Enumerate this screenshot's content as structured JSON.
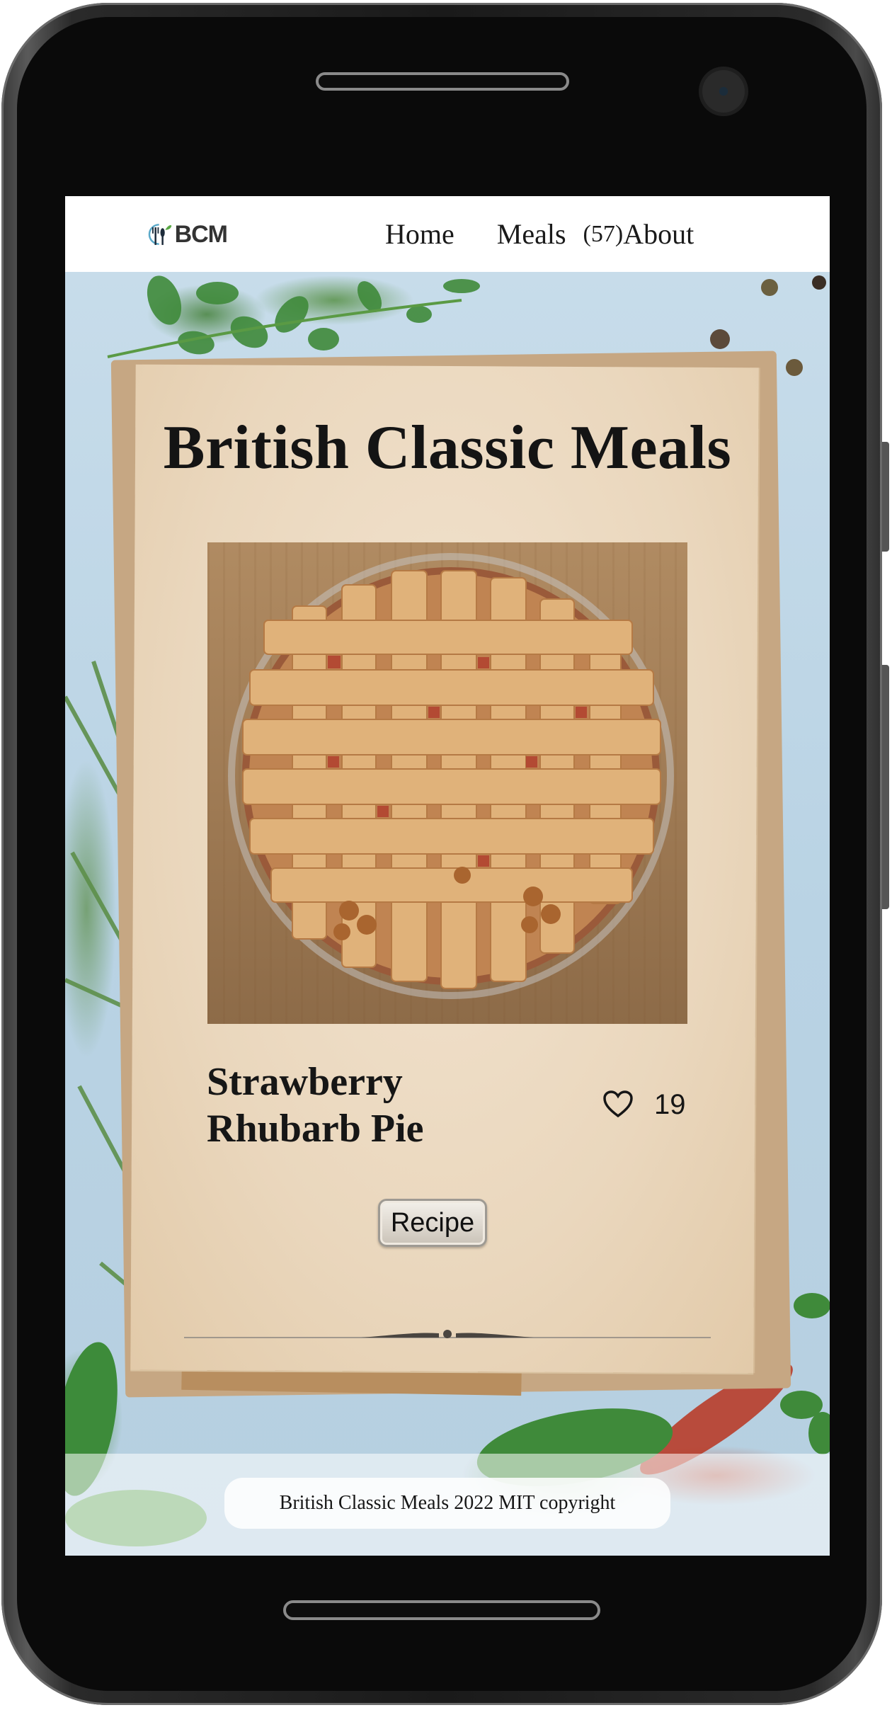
{
  "nav": {
    "logo_text": "BCM",
    "home_label": "Home",
    "meals_label": "Meals",
    "meals_count": "(57)",
    "about_label": "About"
  },
  "page": {
    "title": "British Classic Meals"
  },
  "meal": {
    "name": "Strawberry Rhubarb Pie",
    "likes": "19",
    "recipe_label": "Recipe"
  },
  "footer": {
    "copyright": "British Classic Meals 2022 MIT copyright"
  },
  "colors": {
    "nav_background": "#ffffff",
    "paper": "#ead7bd",
    "text": "#161616",
    "sky_background": "#bcd6e6"
  }
}
